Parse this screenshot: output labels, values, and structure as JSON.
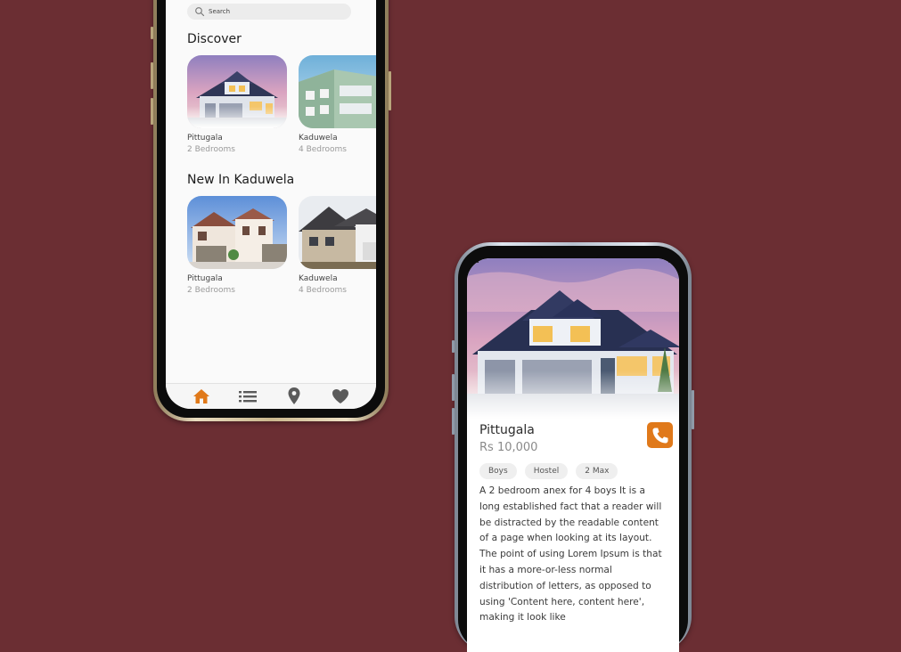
{
  "colors": {
    "background": "#6b2e33",
    "accent": "#e0791a",
    "screen": "#fafafa"
  },
  "home_screen": {
    "search": {
      "placeholder": "Search"
    },
    "sections": [
      {
        "title": "Discover",
        "cards": [
          {
            "name": "Pittugala",
            "bedrooms": "2 Bedrooms"
          },
          {
            "name": "Kaduwela",
            "bedrooms": "4 Bedrooms"
          }
        ]
      },
      {
        "title": "New In Kaduwela",
        "cards": [
          {
            "name": "Pittugala",
            "bedrooms": "2 Bedrooms"
          },
          {
            "name": "Kaduwela",
            "bedrooms": "4 Bedrooms"
          }
        ]
      }
    ],
    "nav": [
      {
        "icon": "home-icon",
        "active": true
      },
      {
        "icon": "list-icon",
        "active": false
      },
      {
        "icon": "location-pin-icon",
        "active": false
      },
      {
        "icon": "heart-icon",
        "active": false
      }
    ]
  },
  "detail_screen": {
    "title": "Pittugala",
    "price": "Rs 10,000",
    "call_icon": "phone-icon",
    "tags": [
      "Boys",
      "Hostel",
      "2 Max"
    ],
    "description": "A 2 bedroom anex for 4 boys It is a long established fact that a reader will be distracted by the readable content of a page when looking at its layout. The point of using Lorem Ipsum is that it has a more-or-less normal distribution of letters, as opposed to using 'Content here, content here', making it look like"
  }
}
